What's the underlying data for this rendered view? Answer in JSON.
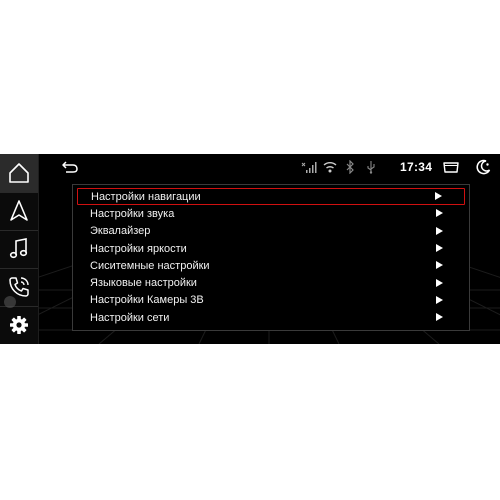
{
  "status": {
    "time": "17:34",
    "icons": [
      "back-arrow-icon",
      "no-signal-icon",
      "wifi-icon",
      "bluetooth-icon",
      "usb-icon",
      "window-icon",
      "night-mode-icon"
    ]
  },
  "dock": {
    "items": [
      "home-icon",
      "navigation-icon",
      "music-icon",
      "phone-icon",
      "settings-gear-icon"
    ],
    "active_index": 0
  },
  "menu": {
    "selected_index": 0,
    "items": [
      {
        "label": "Настройки навигации"
      },
      {
        "label": "Настройки звука"
      },
      {
        "label": "Эквалайзер"
      },
      {
        "label": "Настройки яркости"
      },
      {
        "label": "Сиситемные настройки"
      },
      {
        "label": "Языковые настройки"
      },
      {
        "label": "Настройки Камеры 3В"
      },
      {
        "label": "Настройки сети"
      }
    ]
  },
  "colors": {
    "accent_red": "#d01010",
    "background": "#000000",
    "text": "#f2f2f2"
  }
}
